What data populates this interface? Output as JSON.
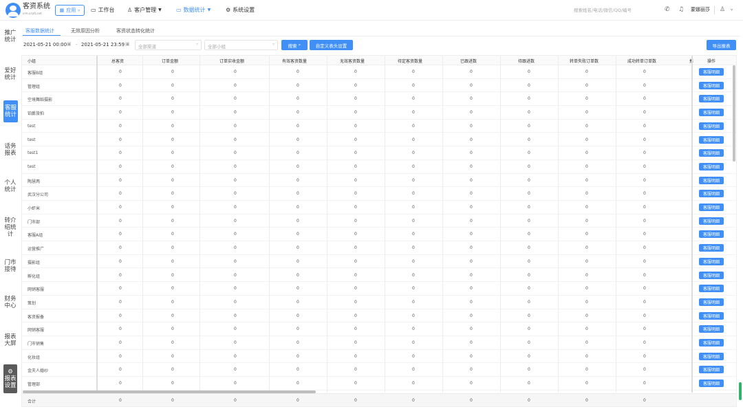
{
  "header": {
    "brand": "客资系统",
    "brand_sub": "crm.v.tyfz.net",
    "app_label": "应用",
    "nav": [
      {
        "label": "工作台",
        "icon": "▭"
      },
      {
        "label": "客户管理",
        "icon": "♙"
      },
      {
        "label": "数据统计",
        "icon": "▭"
      },
      {
        "label": "系统设置",
        "icon": "⚙"
      }
    ],
    "search_placeholder": "搜索姓名/电话/微信/QQ/编号",
    "user_name": "蒙娜丽莎"
  },
  "sidebar": [
    {
      "label": "推广统计"
    },
    {
      "label": "爱好统计"
    },
    {
      "label": "客服统计"
    },
    {
      "label": "话务报表"
    },
    {
      "label": "个人统计"
    },
    {
      "label": "转介绍统计"
    },
    {
      "label": "门市接待"
    },
    {
      "label": "财务中心"
    },
    {
      "label": "报表大屏"
    },
    {
      "label": "报表设置"
    }
  ],
  "tabs": [
    "客服数据统计",
    "无效原因分析",
    "客资状态转化统计"
  ],
  "filters": {
    "start_date": "2021-05-21 00:00",
    "end_date": "2021-05-21 23:59",
    "channel_placeholder": "全部渠道",
    "group_placeholder": "全部小组",
    "search_label": "搜索",
    "custom_header_label": "自定义表头设置",
    "export_label": "导出报表"
  },
  "table": {
    "columns": [
      "小组",
      "总客资",
      "订单金额",
      "订单实收金额",
      "有效客资数量",
      "无效客资数量",
      "待定客资数量",
      "已跟进数",
      "待跟进数",
      "转单失败订单数",
      "成功转单订单数",
      "推",
      "操作"
    ],
    "row_action": "客服明细",
    "rows": [
      [
        "客服B组",
        "0",
        "0",
        "0",
        "0",
        "0",
        "0",
        "0",
        "0",
        "0",
        "0"
      ],
      [
        "管理组",
        "0",
        "0",
        "0",
        "0",
        "0",
        "0",
        "0",
        "0",
        "0",
        "0"
      ],
      [
        "空境舞蹈摄影",
        "0",
        "0",
        "0",
        "0",
        "0",
        "0",
        "0",
        "0",
        "0",
        "0"
      ],
      [
        "铂爵旅拍",
        "0",
        "0",
        "0",
        "0",
        "0",
        "0",
        "0",
        "0",
        "0",
        "0"
      ],
      [
        "test",
        "0",
        "0",
        "0",
        "0",
        "0",
        "0",
        "0",
        "0",
        "0",
        "0"
      ],
      [
        "test",
        "0",
        "0",
        "0",
        "0",
        "0",
        "0",
        "0",
        "0",
        "0",
        "0"
      ],
      [
        "test1",
        "0",
        "0",
        "0",
        "0",
        "0",
        "0",
        "0",
        "0",
        "0",
        "0"
      ],
      [
        "test",
        "0",
        "0",
        "0",
        "0",
        "0",
        "0",
        "0",
        "0",
        "0",
        "0"
      ],
      [
        "陶慧两",
        "0",
        "0",
        "0",
        "0",
        "0",
        "0",
        "0",
        "0",
        "0",
        "0"
      ],
      [
        "武汉分公司",
        "0",
        "0",
        "0",
        "0",
        "0",
        "0",
        "0",
        "0",
        "0",
        "0"
      ],
      [
        "小虾米",
        "0",
        "0",
        "0",
        "0",
        "0",
        "0",
        "0",
        "0",
        "0",
        "0"
      ],
      [
        "门市部",
        "0",
        "0",
        "0",
        "0",
        "0",
        "0",
        "0",
        "0",
        "0",
        "0"
      ],
      [
        "客服A组",
        "0",
        "0",
        "0",
        "0",
        "0",
        "0",
        "0",
        "0",
        "0",
        "0"
      ],
      [
        "运营推广",
        "0",
        "0",
        "0",
        "0",
        "0",
        "0",
        "0",
        "0",
        "0",
        "0"
      ],
      [
        "摄影组",
        "0",
        "0",
        "0",
        "0",
        "0",
        "0",
        "0",
        "0",
        "0",
        "0"
      ],
      [
        "孵化组",
        "0",
        "0",
        "0",
        "0",
        "0",
        "0",
        "0",
        "0",
        "0",
        "0"
      ],
      [
        "网销客服",
        "0",
        "0",
        "0",
        "0",
        "0",
        "0",
        "0",
        "0",
        "0",
        "0"
      ],
      [
        "策划",
        "0",
        "0",
        "0",
        "0",
        "0",
        "0",
        "0",
        "0",
        "0",
        "0"
      ],
      [
        "客资报备",
        "0",
        "0",
        "0",
        "0",
        "0",
        "0",
        "0",
        "0",
        "0",
        "0"
      ],
      [
        "网销客服",
        "0",
        "0",
        "0",
        "0",
        "0",
        "0",
        "0",
        "0",
        "0",
        "0"
      ],
      [
        "门市销售",
        "0",
        "0",
        "0",
        "0",
        "0",
        "0",
        "0",
        "0",
        "0",
        "0"
      ],
      [
        "化妆组",
        "0",
        "0",
        "0",
        "0",
        "0",
        "0",
        "0",
        "0",
        "0",
        "0"
      ],
      [
        "金夫人婚纱",
        "0",
        "0",
        "0",
        "0",
        "0",
        "0",
        "0",
        "0",
        "0",
        "0"
      ],
      [
        "管理部",
        "0",
        "0",
        "0",
        "0",
        "0",
        "0",
        "0",
        "0",
        "0",
        "0"
      ]
    ],
    "total": [
      "合计",
      "0",
      "0",
      "0",
      "0",
      "0",
      "0",
      "0",
      "0",
      "0",
      "0"
    ]
  },
  "colors": {
    "accent": "#3f8ff7",
    "settings_bg": "#5a5a5a",
    "scroll_indicator": "#2fb36b"
  }
}
